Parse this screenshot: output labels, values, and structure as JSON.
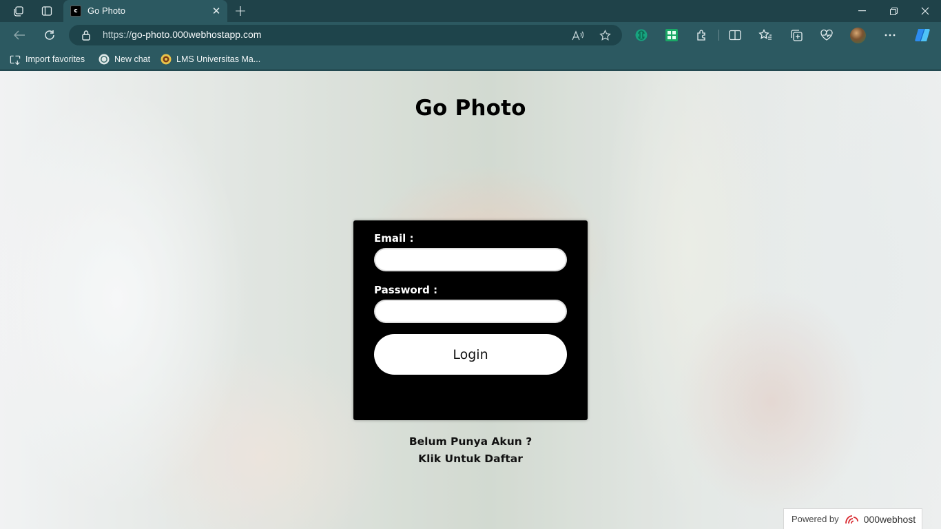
{
  "browser": {
    "tab": {
      "title": "Go Photo",
      "favicon_text": "c"
    },
    "address": {
      "scheme": "https://",
      "host": "go-photo.000webhostapp.com"
    },
    "favorites": [
      {
        "label": "Import favorites",
        "icon": "import-favorites-icon"
      },
      {
        "label": "New chat",
        "icon": "chat-icon"
      },
      {
        "label": "LMS Universitas Ma...",
        "icon": "university-icon"
      }
    ]
  },
  "page": {
    "title": "Go Photo",
    "form": {
      "email_label": "Email :",
      "email_value": "",
      "password_label": "Password :",
      "password_value": "",
      "submit_label": "Login"
    },
    "signup": {
      "line1": "Belum Punya Akun ?",
      "line2": "Klik Untuk Daftar"
    },
    "footer": {
      "powered_by": "Powered by",
      "brand": "000webhost"
    }
  },
  "colors": {
    "chrome_dark": "#1f4249",
    "chrome": "#2c5961",
    "card": "#000000",
    "brand_red": "#d8272d"
  }
}
